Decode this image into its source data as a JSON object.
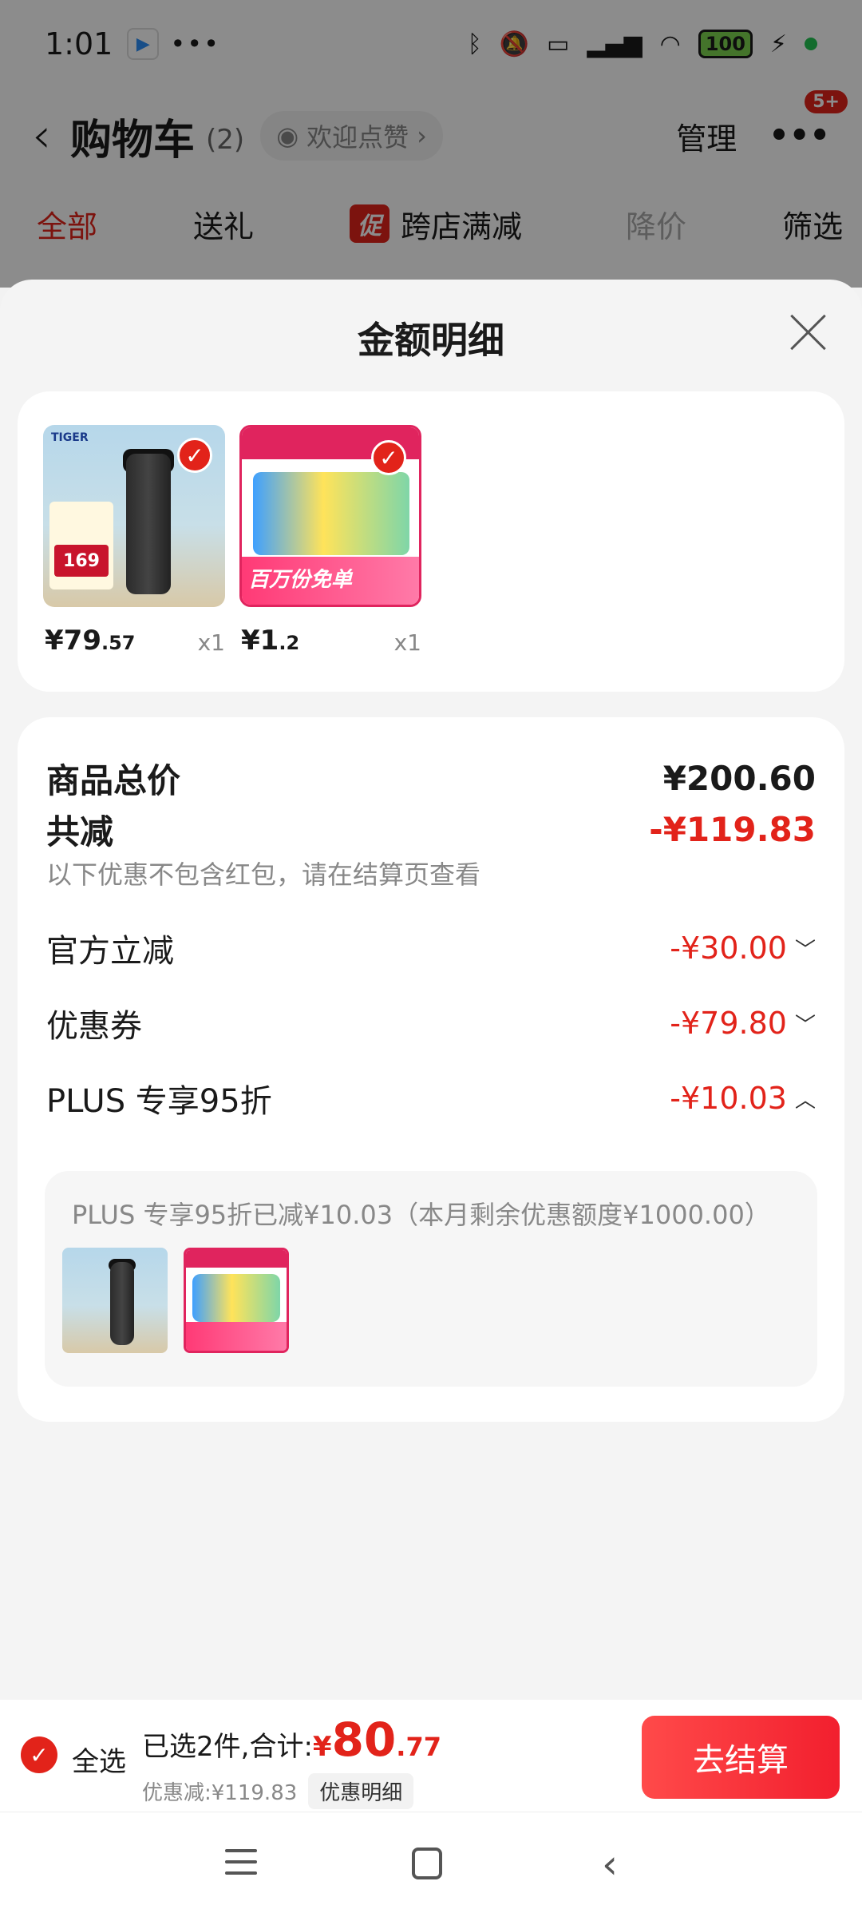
{
  "status_bar": {
    "time": "1:01",
    "dots": "•••",
    "battery": "100"
  },
  "header": {
    "title": "购物车",
    "count": "(2)",
    "welcome": "欢迎点赞",
    "manage": "管理",
    "badge": "5+"
  },
  "tabs": {
    "all": "全部",
    "gift": "送礼",
    "promo_badge": "促",
    "cross_store": "跨店满减",
    "price_drop": "降价",
    "filter": "筛选"
  },
  "sheet": {
    "title": "金额明细",
    "products": [
      {
        "price_int": "¥79",
        "price_dec": ".57",
        "qty": "x1",
        "brand": "TIGER",
        "tag_price": "169"
      },
      {
        "price_int": "¥1",
        "price_dec": ".2",
        "qty": "x1",
        "banner": "百万份免单"
      }
    ],
    "total_label": "商品总价",
    "total_value": "¥200.60",
    "reduce_label": "共减",
    "reduce_value": "-¥119.83",
    "reduce_note": "以下优惠不包含红包，请在结算页查看",
    "official_label": "官方立减",
    "official_value": "-¥30.00",
    "coupon_label": "优惠券",
    "coupon_value": "-¥79.80",
    "plus_label": "PLUS 专享95折",
    "plus_value": "-¥10.03",
    "plus_note": "PLUS 专享95折已减¥10.03（本月剩余优惠额度¥1000.00）"
  },
  "bottom_bar": {
    "select_all": "全选",
    "selected_text": "已选2件,合计:",
    "total_symbol": "¥",
    "total_int": "80",
    "total_dec": ".77",
    "discount_text": "优惠减:¥119.83",
    "detail_chip": "优惠明细",
    "checkout": "去结算"
  },
  "colors": {
    "accent": "#e2231a",
    "sheet_bg": "#f4f4f4"
  }
}
